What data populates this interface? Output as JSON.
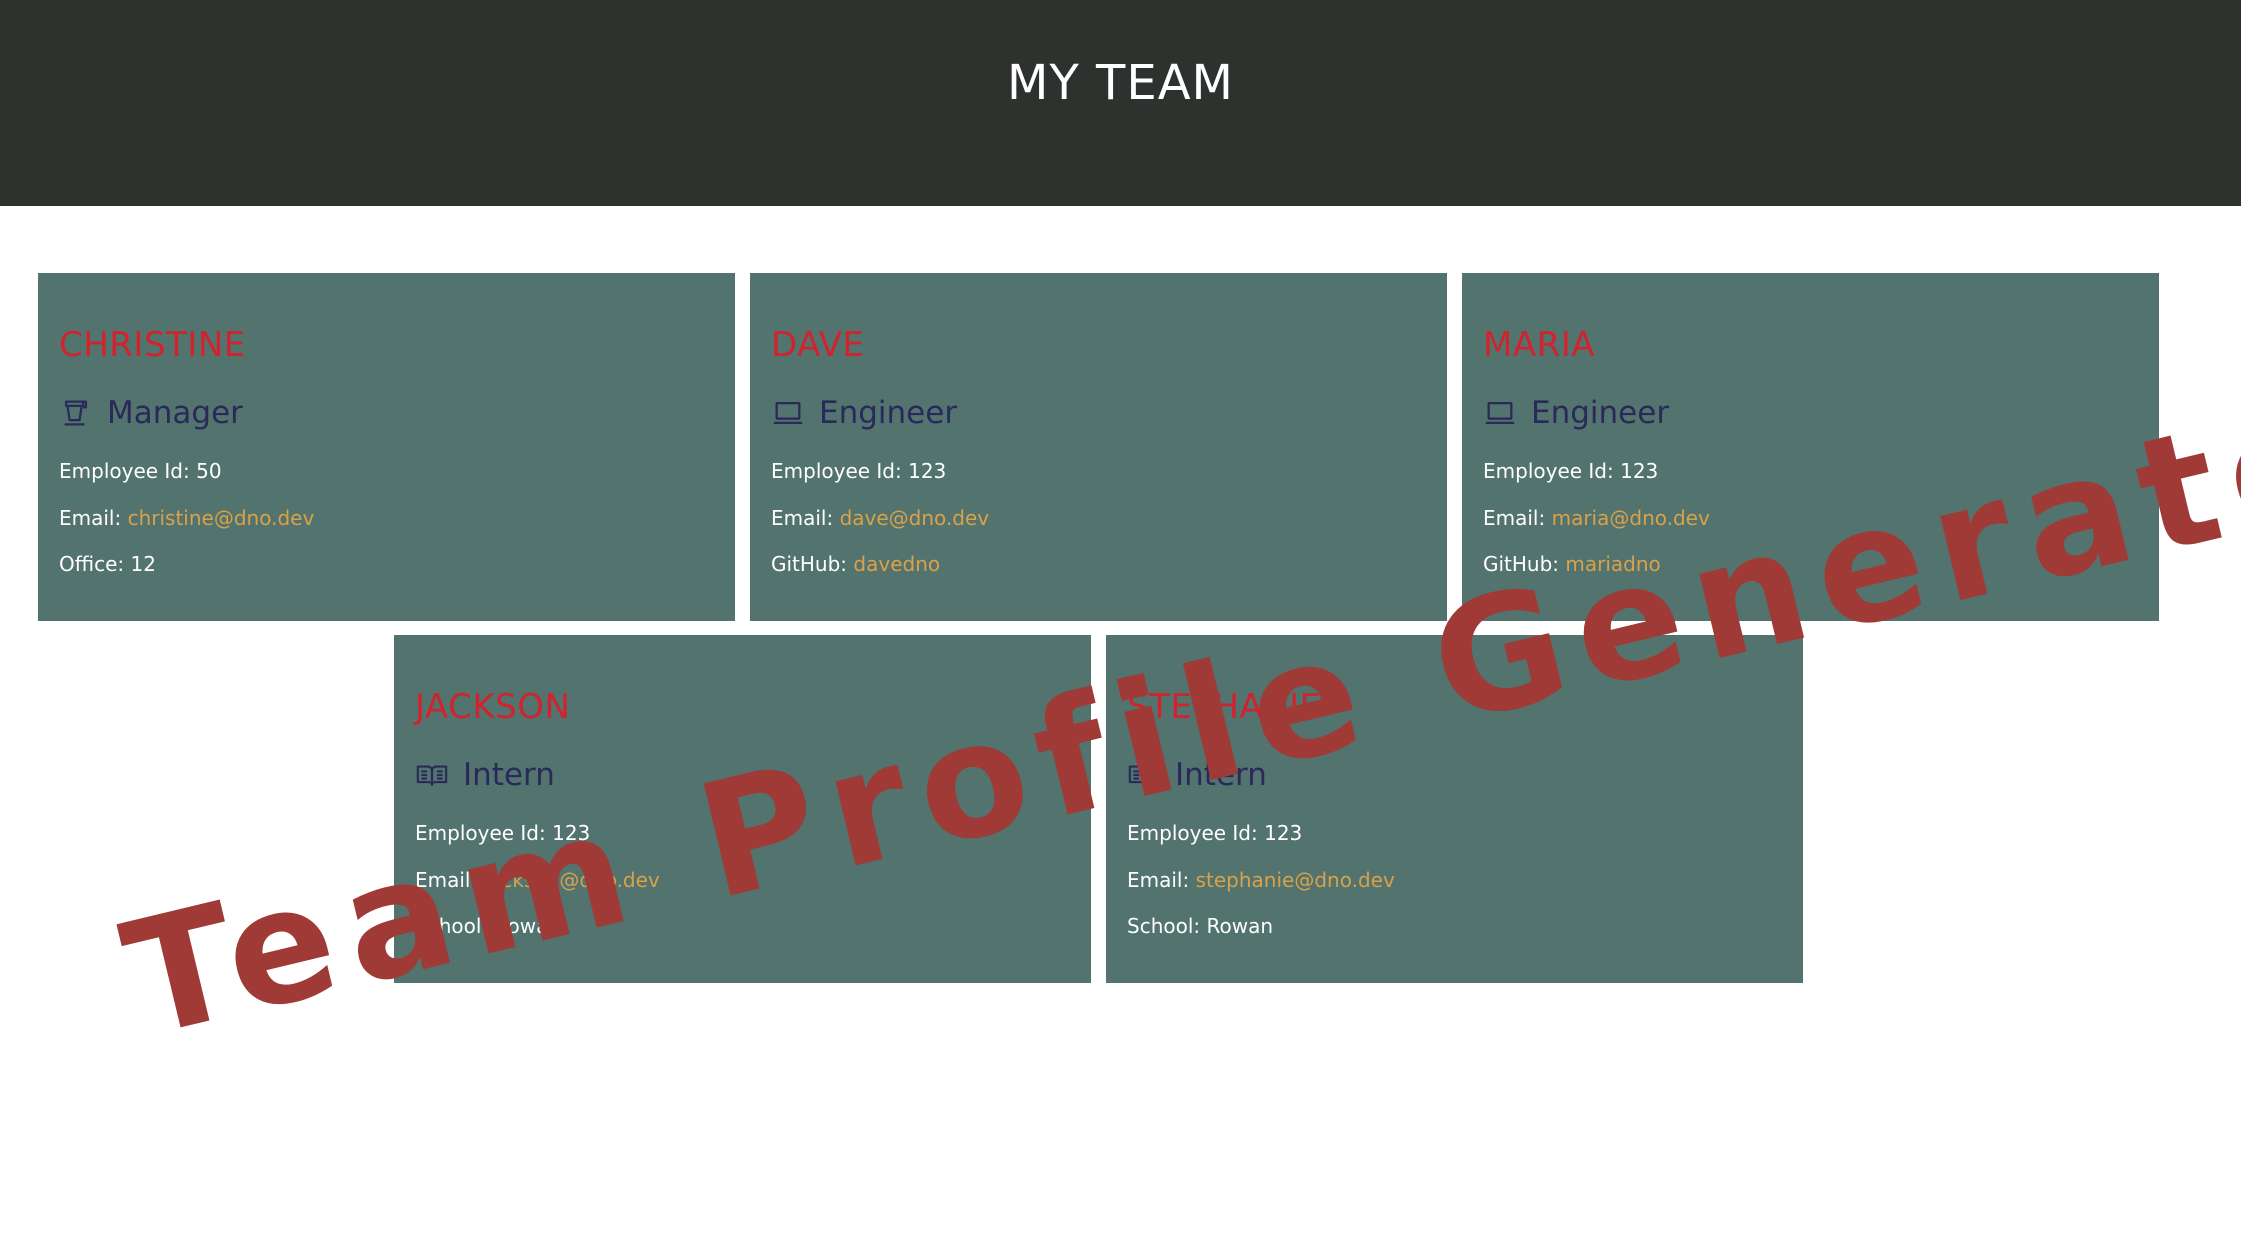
{
  "header": {
    "title": "MY TEAM"
  },
  "cards": [
    {
      "name": "CHRISTINE",
      "role": "Manager",
      "role_icon": "coffee-cup-icon",
      "id_label": "Employee Id:",
      "id_value": "50",
      "email_label": "Email:",
      "email": "christine@dno.dev",
      "extra_label": "Office:",
      "extra_value": "12"
    },
    {
      "name": "DAVE",
      "role": "Engineer",
      "role_icon": "laptop-icon",
      "id_label": "Employee Id:",
      "id_value": "123",
      "email_label": "Email:",
      "email": "dave@dno.dev",
      "extra_label": "GitHub:",
      "extra_value": "davedno"
    },
    {
      "name": "MARIA",
      "role": "Engineer",
      "role_icon": "laptop-icon",
      "id_label": "Employee Id:",
      "id_value": "123",
      "email_label": "Email:",
      "email": "maria@dno.dev",
      "extra_label": "GitHub:",
      "extra_value": "mariadno"
    },
    {
      "name": "JACKSON",
      "role": "Intern",
      "role_icon": "open-book-icon",
      "id_label": "Employee Id:",
      "id_value": "123",
      "email_label": "Email:",
      "email": "jackson@dno.dev",
      "extra_label": "School:",
      "extra_value": "Rowan"
    },
    {
      "name": "STEPHANIE",
      "role": "Intern",
      "role_icon": "open-book-icon",
      "id_label": "Employee Id:",
      "id_value": "123",
      "email_label": "Email:",
      "email": "stephanie@dno.dev",
      "extra_label": "School:",
      "extra_value": "Rowan"
    }
  ],
  "watermark": {
    "text": "Team Profile Generator"
  },
  "colors": {
    "header_bg": "#2e322f",
    "card_bg": "#53736e",
    "name": "#d1232e",
    "role": "#2a2a5a",
    "link": "#d9a24a",
    "watermark": "#a03a36"
  }
}
